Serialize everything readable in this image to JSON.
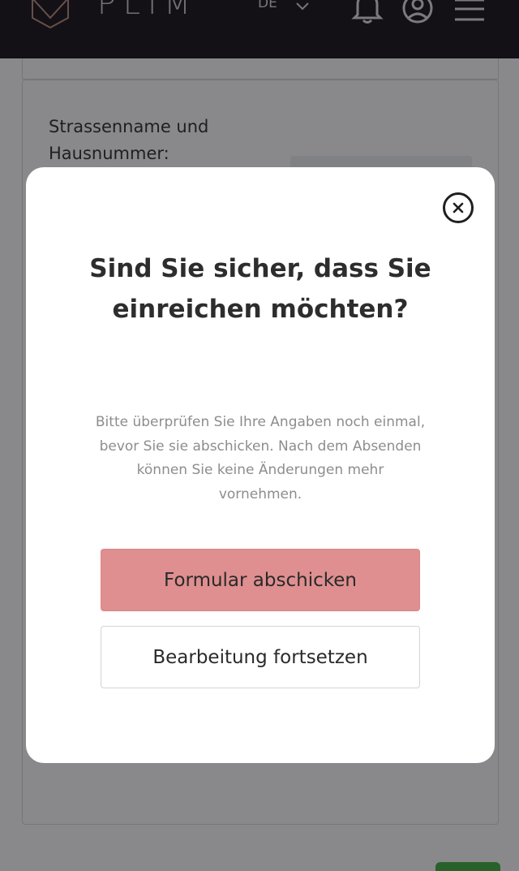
{
  "header": {
    "logo_text": "PLIM",
    "language": "DE",
    "icons": [
      "logo-icon",
      "chevron-down-icon",
      "bell-icon",
      "user-icon",
      "menu-icon"
    ]
  },
  "form": {
    "street_label": "Strassenname und Hausnummer:"
  },
  "modal": {
    "title": "Sind Sie sicher, dass Sie einreichen möchten?",
    "body": "Bitte überprüfen Sie Ihre Angaben noch einmal, bevor Sie sie abschicken. Nach dem Absenden können Sie keine Änderungen mehr vornehmen.",
    "submit_label": "Formular abschicken",
    "continue_label": "Bearbeitung fortsetzen"
  },
  "colors": {
    "header_bg": "#120f14",
    "primary_button": "#df8f90",
    "overlay": "rgba(20,20,24,0.5)",
    "accent_green": "#3fae3f"
  }
}
